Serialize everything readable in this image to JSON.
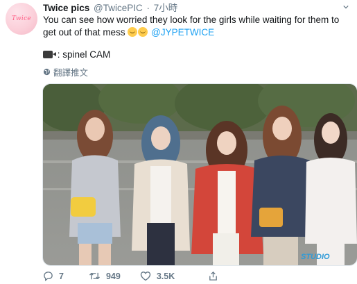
{
  "tweet": {
    "avatar_text": "Twice",
    "display_name": "Twice pics",
    "handle": "@TwicePIC",
    "separator": "·",
    "time": "7小時",
    "text_main": "You can see how worried they look for the girls while waiting for them to get out of that mess",
    "mention": "@JYPETWICE",
    "cam_text": ": spinel CAM",
    "translate_label": "翻譯推文",
    "watermark": "STUDIO",
    "replies": "7",
    "retweets": "949",
    "likes": "3.5K"
  },
  "colors": {
    "accent": "#1da1f2",
    "secondary_text": "#657786",
    "primary_text": "#14171a"
  },
  "icons": [
    "chevron-down-icon",
    "emoji-icon",
    "video-camera-icon",
    "globe-icon",
    "reply-icon",
    "retweet-icon",
    "like-icon",
    "share-icon"
  ]
}
